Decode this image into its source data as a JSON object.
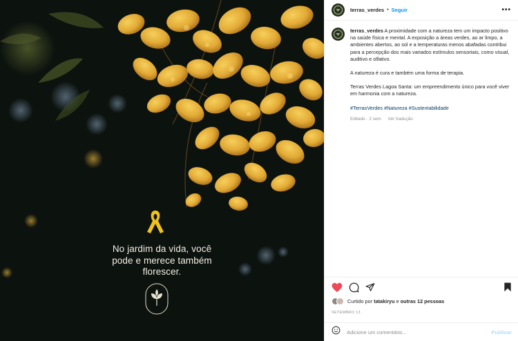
{
  "post": {
    "overlay_lines": [
      "No jardim da vida, você",
      "pode e merece também",
      "florescer."
    ]
  },
  "header": {
    "username": "terras_verdes",
    "separator": "•",
    "follow_label": "Seguir",
    "more_label": "•••"
  },
  "caption": {
    "username": "terras_verdes",
    "paragraph1": "A proximidade com a natureza tem um impacto positivo na saúde física e mental. A exposição a áreas verdes, ao ar limpo, a ambientes abertos, ao sol e a temperaturas menos abafadas contribui para a percepção dos mais variados estímulos sensoriais, como visual, auditivo e olfativo.",
    "paragraph2": "A natureza é cura e também uma forma de terapia.",
    "paragraph3": "Terras Verdes Lagoa Santa: um empreendimento único para você viver em harmonia com a natureza.",
    "hashtags": "#TerrasVerdes #Natureza #Sustentabilidade",
    "edited": "Editado · 2 sem",
    "translate": "Ver tradução"
  },
  "actions": {
    "icons": [
      "heart-icon",
      "comment-icon",
      "share-icon",
      "bookmark-icon"
    ],
    "like_color": "#ed4956"
  },
  "likes": {
    "prefix": "Curtido por",
    "user": "tatakiryu",
    "middle": "e",
    "others": "outras 12 pessoas"
  },
  "date": "SETEMBRO 13",
  "comment": {
    "placeholder": "Adicione um comentário...",
    "publish_label": "Publicar"
  }
}
